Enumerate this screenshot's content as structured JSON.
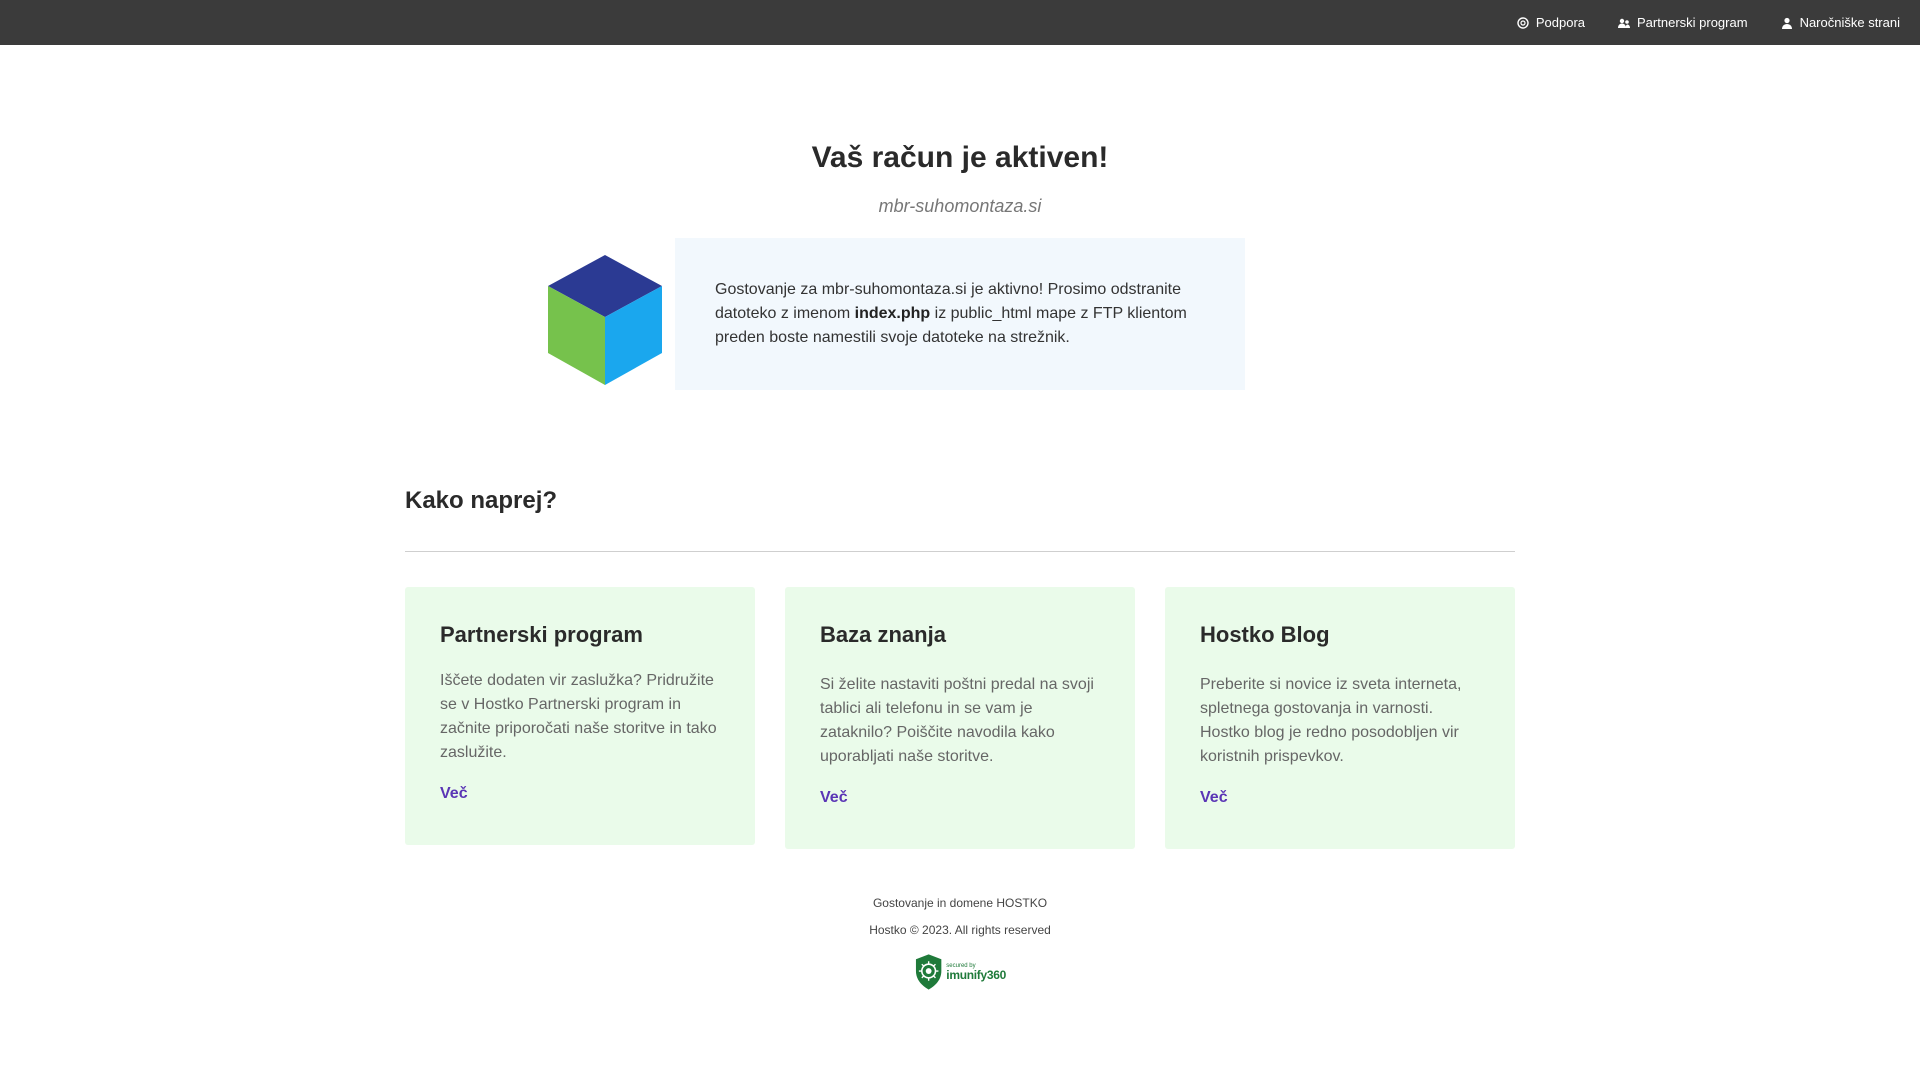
{
  "topnav": {
    "items": [
      {
        "label": "Podpora",
        "icon": "support-icon"
      },
      {
        "label": "Partnerski program",
        "icon": "partner-icon"
      },
      {
        "label": "Naročniške strani",
        "icon": "user-icon"
      }
    ]
  },
  "hero": {
    "title": "Vaš račun je aktiven!",
    "domain": "mbr-suhomontaza.si",
    "notice_before": "Gostovanje za mbr-suhomontaza.si je aktivno! Prosimo odstranite datoteko z imenom ",
    "notice_bold": "index.php",
    "notice_after": " iz public_html mape z FTP klientom preden boste namestili svoje datoteke na strežnik."
  },
  "section": {
    "title": "Kako naprej?"
  },
  "cards": [
    {
      "title": "Partnerski program",
      "text": "Iščete dodaten vir zaslužka? Pridružite se v Hostko Partnerski program in začnite priporočati naše storitve in tako zaslužite.",
      "link": "Več"
    },
    {
      "title": "Baza znanja",
      "text": "Si želite nastaviti poštni predal na svoji tablici ali telefonu in se vam je zataknilo? Poiščite navodila kako uporabljati naše storitve.",
      "link": "Več"
    },
    {
      "title": "Hostko Blog",
      "text": "Preberite si novice iz sveta interneta, spletnega gostovanja in varnosti. Hostko blog je redno posodobljen vir koristnih prispevkov.",
      "link": "Več"
    }
  ],
  "footer": {
    "line1": "Gostovanje in domene HOSTKO",
    "line2": "Hostko © 2023. All rights reserved",
    "badge_small": "secured by",
    "badge_big": "imunify360"
  },
  "colors": {
    "topbar": "#3b3b3b",
    "notice_bg": "#f2f8fd",
    "card_bg": "#eafbea",
    "link": "#5a35b5",
    "cube_top": "#2b3a93",
    "cube_left": "#76c24c",
    "cube_right": "#1aa7ee",
    "badge_green": "#1f7a3a"
  }
}
